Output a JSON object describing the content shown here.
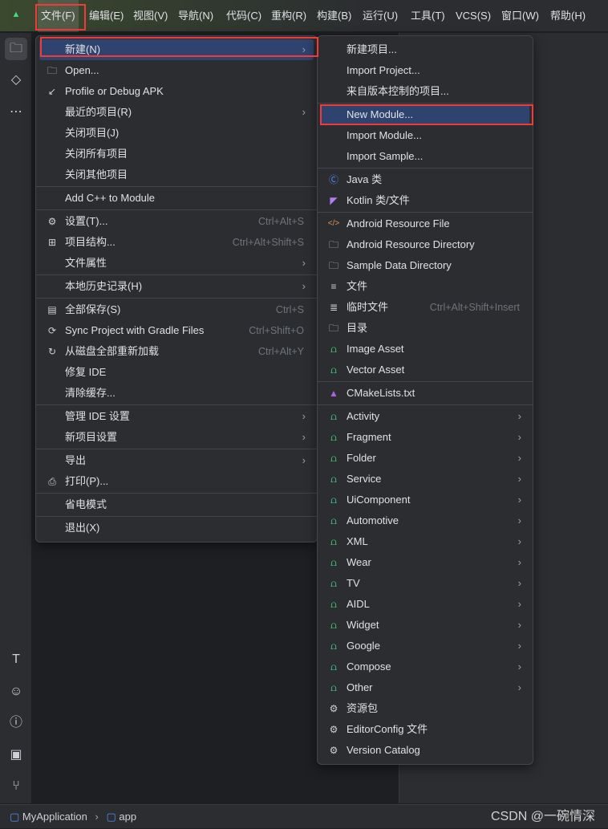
{
  "menubar": [
    "文件(F)",
    "编辑(E)",
    "视图(V)",
    "导航(N)",
    "代码(C)",
    "重构(R)",
    "构建(B)",
    "运行(U)",
    "工具(T)",
    "VCS(S)",
    "窗口(W)",
    "帮助(H)"
  ],
  "file_menu": [
    {
      "label": "新建(N)",
      "submenu": true,
      "selected": true
    },
    {
      "label": "Open...",
      "icon": "folder-icon"
    },
    {
      "label": "Profile or Debug APK",
      "icon": "profile-icon"
    },
    {
      "label": "最近的项目(R)",
      "submenu": true
    },
    {
      "label": "关闭项目(J)"
    },
    {
      "label": "关闭所有项目"
    },
    {
      "label": "关闭其他项目"
    },
    {
      "sep": true
    },
    {
      "label": "Add C++ to Module"
    },
    {
      "sep": true
    },
    {
      "label": "设置(T)...",
      "icon": "gear-icon",
      "shortcut": "Ctrl+Alt+S"
    },
    {
      "label": "项目结构...",
      "icon": "project-structure-icon",
      "shortcut": "Ctrl+Alt+Shift+S"
    },
    {
      "label": "文件属性",
      "submenu": true
    },
    {
      "sep": true
    },
    {
      "label": "本地历史记录(H)",
      "submenu": true
    },
    {
      "sep": true
    },
    {
      "label": "全部保存(S)",
      "icon": "save-icon",
      "shortcut": "Ctrl+S"
    },
    {
      "label": "Sync Project with Gradle Files",
      "icon": "sync-gradle-icon",
      "shortcut": "Ctrl+Shift+O"
    },
    {
      "label": "从磁盘全部重新加载",
      "icon": "reload-icon",
      "shortcut": "Ctrl+Alt+Y"
    },
    {
      "label": "修复 IDE"
    },
    {
      "label": "清除缓存..."
    },
    {
      "sep": true
    },
    {
      "label": "管理 IDE 设置",
      "submenu": true
    },
    {
      "label": "新项目设置",
      "submenu": true
    },
    {
      "sep": true
    },
    {
      "label": "导出",
      "submenu": true
    },
    {
      "label": "打印(P)...",
      "icon": "print-icon"
    },
    {
      "sep": true
    },
    {
      "label": "省电模式"
    },
    {
      "sep": true
    },
    {
      "label": "退出(X)"
    }
  ],
  "new_menu": [
    {
      "label": "新建项目..."
    },
    {
      "label": "Import Project..."
    },
    {
      "label": "来自版本控制的项目..."
    },
    {
      "sep": true
    },
    {
      "label": "New Module...",
      "selected": true
    },
    {
      "label": "Import Module..."
    },
    {
      "label": "Import Sample..."
    },
    {
      "sep": true
    },
    {
      "label": "Java 类",
      "icon": "java-class-icon"
    },
    {
      "label": "Kotlin 类/文件",
      "icon": "kotlin-icon"
    },
    {
      "sep": true
    },
    {
      "label": "Android Resource File",
      "icon": "xml-code-icon"
    },
    {
      "label": "Android Resource Directory",
      "icon": "folder-icon"
    },
    {
      "label": "Sample Data Directory",
      "icon": "folder-icon"
    },
    {
      "label": "文件",
      "icon": "file-icon"
    },
    {
      "label": "临时文件",
      "icon": "scratch-file-icon",
      "shortcut": "Ctrl+Alt+Shift+Insert"
    },
    {
      "label": "目录",
      "icon": "folder-icon"
    },
    {
      "label": "Image Asset",
      "icon": "android-icon"
    },
    {
      "label": "Vector Asset",
      "icon": "android-icon"
    },
    {
      "sep": true
    },
    {
      "label": "CMakeLists.txt",
      "icon": "cmake-icon"
    },
    {
      "sep": true
    },
    {
      "label": "Activity",
      "icon": "android-icon",
      "submenu": true
    },
    {
      "label": "Fragment",
      "icon": "android-icon",
      "submenu": true
    },
    {
      "label": "Folder",
      "icon": "android-icon",
      "submenu": true
    },
    {
      "label": "Service",
      "icon": "android-icon",
      "submenu": true
    },
    {
      "label": "UiComponent",
      "icon": "android-icon",
      "submenu": true
    },
    {
      "label": "Automotive",
      "icon": "android-icon",
      "submenu": true
    },
    {
      "label": "XML",
      "icon": "android-icon",
      "submenu": true
    },
    {
      "label": "Wear",
      "icon": "android-icon",
      "submenu": true
    },
    {
      "label": "TV",
      "icon": "android-icon",
      "submenu": true
    },
    {
      "label": "AIDL",
      "icon": "android-icon",
      "submenu": true
    },
    {
      "label": "Widget",
      "icon": "android-icon",
      "submenu": true
    },
    {
      "label": "Google",
      "icon": "android-icon",
      "submenu": true
    },
    {
      "label": "Compose",
      "icon": "android-icon",
      "submenu": true
    },
    {
      "label": "Other",
      "icon": "android-icon",
      "submenu": true
    },
    {
      "label": "资源包",
      "icon": "gear-icon"
    },
    {
      "label": "EditorConfig 文件",
      "icon": "gear-icon"
    },
    {
      "label": "Version Catalog",
      "icon": "version-catalog-icon"
    }
  ],
  "breadcrumb": [
    "MyApplication",
    "app"
  ],
  "watermark": "CSDN @一碗情深",
  "colors": {
    "selection": "#2e436e",
    "highlight_box": "#f23a3a",
    "android": "#3ddc84"
  }
}
